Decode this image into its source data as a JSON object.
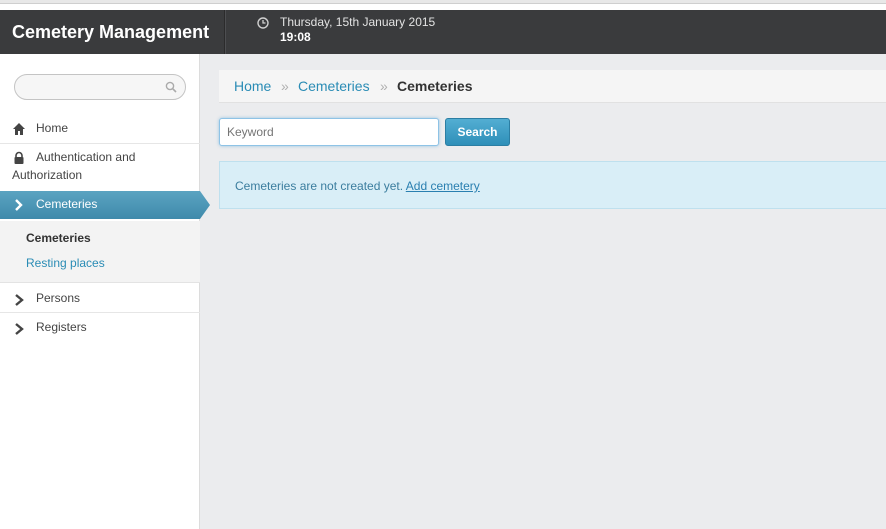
{
  "app": {
    "title": "Cemetery Management",
    "date": "Thursday, 15th January 2015",
    "time": "19:08"
  },
  "sidebar": {
    "search": {
      "placeholder": "",
      "value": ""
    },
    "items": [
      {
        "label": "Home",
        "icon": "home-icon"
      },
      {
        "label_line1": "Authentication and",
        "label_line2": "Authorization",
        "icon": "lock-icon"
      },
      {
        "label": "Cemeteries",
        "icon": "chevron-right-icon",
        "active": true
      },
      {
        "label": "Persons",
        "icon": "chevron-right-icon"
      },
      {
        "label": "Registers",
        "icon": "chevron-right-icon"
      }
    ],
    "subitems": [
      {
        "label": "Cemeteries",
        "current": true
      },
      {
        "label": "Resting places"
      }
    ]
  },
  "breadcrumb": {
    "home": "Home",
    "separator": "»",
    "parent": "Cemeteries",
    "current": "Cemeteries"
  },
  "search": {
    "placeholder": "Keyword",
    "value": "",
    "button_label": "Search"
  },
  "alert": {
    "message": "Cemeteries are not created yet. ",
    "link_label": "Add cemetery"
  },
  "colors": {
    "topbar": "#3a3b3d",
    "accent": "#2a8cb5",
    "active_nav": "#4f97b6",
    "alert_bg": "#d9eef7"
  }
}
